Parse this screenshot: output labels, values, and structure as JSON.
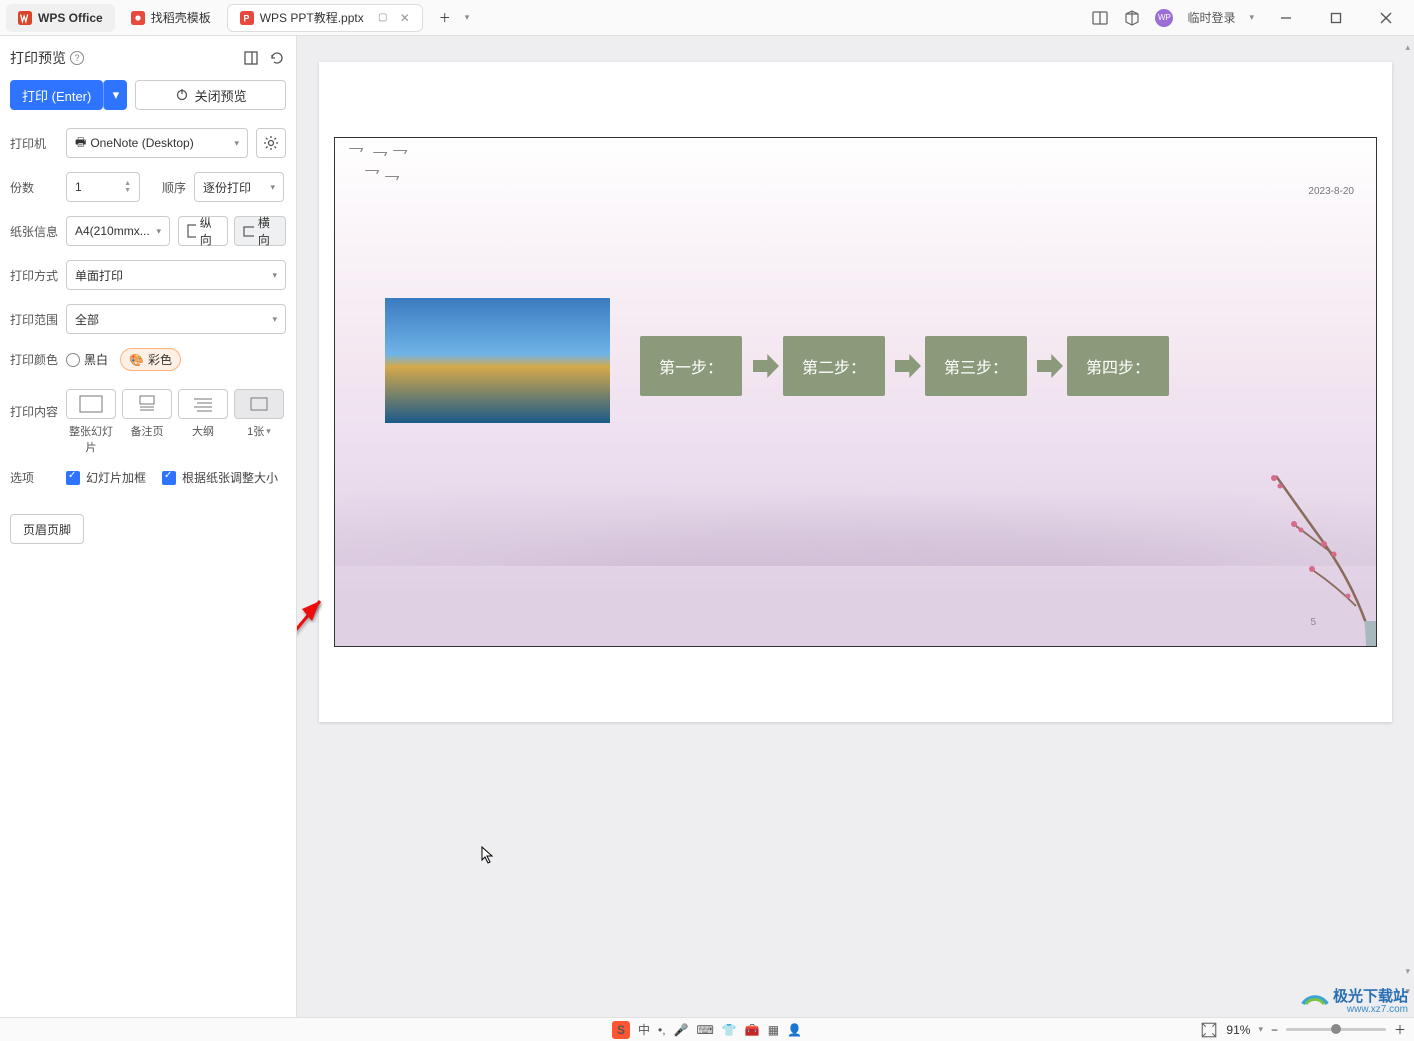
{
  "titlebar": {
    "app_name": "WPS Office",
    "tab_templates": "找稻壳模板",
    "tab_file": "WPS PPT教程.pptx",
    "login": "临时登录"
  },
  "sidebar": {
    "title": "打印预览",
    "print_btn": "打印 (Enter)",
    "close_preview": "关闭预览",
    "printer_label": "打印机",
    "printer_value": "OneNote (Desktop)",
    "copies_label": "份数",
    "copies_value": "1",
    "order_label": "顺序",
    "order_value": "逐份打印",
    "paper_label": "纸张信息",
    "paper_value": "A4(210mmx...",
    "portrait": "纵向",
    "landscape": "横向",
    "method_label": "打印方式",
    "method_value": "单面打印",
    "range_label": "打印范围",
    "range_value": "全部",
    "color_label": "打印颜色",
    "bw": "黑白",
    "color": "彩色",
    "content_label": "打印内容",
    "pc_full": "整张幻灯片",
    "pc_notes": "备注页",
    "pc_outline": "大纲",
    "pc_1up": "1张",
    "options_label": "选项",
    "cb_frame": "幻灯片加框",
    "cb_fit": "根据纸张调整大小",
    "hf_btn": "页眉页脚"
  },
  "slide": {
    "date": "2023-8-20",
    "page_num": "5",
    "step1": "第一步：",
    "step2": "第二步：",
    "step3": "第三步：",
    "step4": "第四步："
  },
  "statusbar": {
    "ime_lang": "中",
    "zoom": "91%"
  },
  "watermark": {
    "brand": "极光下载站",
    "url": "www.xz7.com"
  }
}
